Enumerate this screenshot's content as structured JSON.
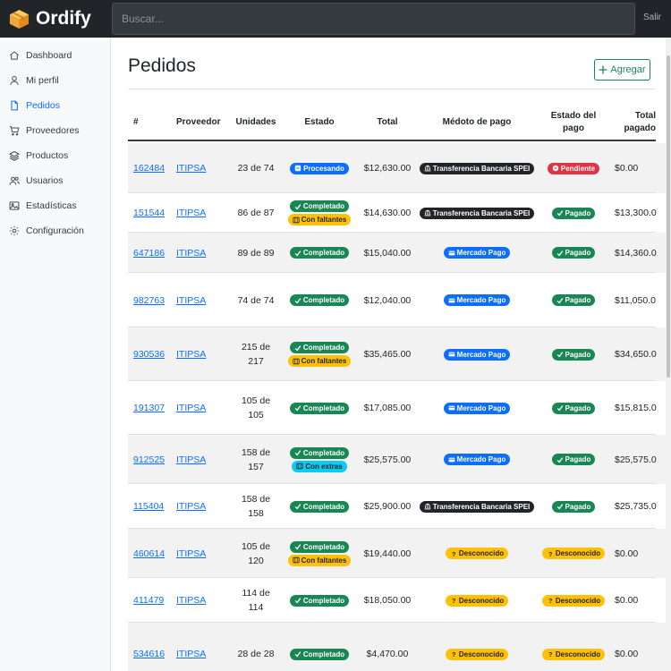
{
  "app": {
    "name": "Ordify"
  },
  "search": {
    "placeholder": "Buscar..."
  },
  "topbar": {
    "logout_label": "Salir"
  },
  "sidebar": {
    "items": [
      {
        "label": "Dashboard",
        "icon": "home-icon"
      },
      {
        "label": "Mi perfil",
        "icon": "user-icon"
      },
      {
        "label": "Pedidos",
        "icon": "file-icon",
        "active": true
      },
      {
        "label": "Proveedores",
        "icon": "cart-icon"
      },
      {
        "label": "Productos",
        "icon": "layers-icon"
      },
      {
        "label": "Usuarios",
        "icon": "users-icon"
      },
      {
        "label": "Estadísticas",
        "icon": "image-icon"
      },
      {
        "label": "Configuración",
        "icon": "gear-icon"
      }
    ]
  },
  "page": {
    "title": "Pedidos",
    "add_label": "Agregar"
  },
  "table": {
    "headers": {
      "num": "#",
      "proveedor": "Proveedor",
      "unidades": "Unidades",
      "estado": "Estado",
      "total": "Total",
      "metodo": "Médoto de pago",
      "estado_pago_1": "Estado del",
      "estado_pago_2": "pago",
      "total_pagado_1": "Total",
      "total_pagado_2": "pagado"
    },
    "rows": [
      {
        "id": "162484",
        "proveedor": "ITIPSA",
        "units1": "23 de 74",
        "units2": "",
        "estado": [
          {
            "label": "Procesando",
            "kind": "primary"
          }
        ],
        "total": "$12,630.00",
        "metodo": {
          "label": "Transferencia Bancaria SPEI",
          "kind": "dark"
        },
        "pago": {
          "label": "Pendiente",
          "kind": "danger"
        },
        "pagado": "$0.00"
      },
      {
        "id": "151544",
        "proveedor": "ITIPSA",
        "units1": "86 de 87",
        "units2": "",
        "estado": [
          {
            "label": "Completado",
            "kind": "success"
          },
          {
            "label": "Con faltantes",
            "kind": "warning"
          }
        ],
        "total": "$14,630.00",
        "metodo": {
          "label": "Transferencia Bancaria SPEI",
          "kind": "dark"
        },
        "pago": {
          "label": "Pagado",
          "kind": "success"
        },
        "pagado": "$13,300.0"
      },
      {
        "id": "647186",
        "proveedor": "ITIPSA",
        "units1": "89 de 89",
        "units2": "",
        "estado": [
          {
            "label": "Completado",
            "kind": "success"
          }
        ],
        "total": "$15,040.00",
        "metodo": {
          "label": "Mercado Pago",
          "kind": "primary"
        },
        "pago": {
          "label": "Pagado",
          "kind": "success"
        },
        "pagado": "$14,360.0"
      },
      {
        "id": "982763",
        "proveedor": "ITIPSA",
        "units1": "74 de 74",
        "units2": "",
        "estado": [
          {
            "label": "Completado",
            "kind": "success"
          }
        ],
        "total": "$12,040.00",
        "metodo": {
          "label": "Mercado Pago",
          "kind": "primary"
        },
        "pago": {
          "label": "Pagado",
          "kind": "success"
        },
        "pagado": "$11,050.0"
      },
      {
        "id": "930536",
        "proveedor": "ITIPSA",
        "units1": "215 de",
        "units2": "217",
        "estado": [
          {
            "label": "Completado",
            "kind": "success"
          },
          {
            "label": "Con faltantes",
            "kind": "warning"
          }
        ],
        "total": "$35,465.00",
        "metodo": {
          "label": "Mercado Pago",
          "kind": "primary"
        },
        "pago": {
          "label": "Pagado",
          "kind": "success"
        },
        "pagado": "$34,650.0"
      },
      {
        "id": "191307",
        "proveedor": "ITIPSA",
        "units1": "105 de",
        "units2": "105",
        "estado": [
          {
            "label": "Completado",
            "kind": "success"
          }
        ],
        "total": "$17,085.00",
        "metodo": {
          "label": "Mercado Pago",
          "kind": "primary"
        },
        "pago": {
          "label": "Pagado",
          "kind": "success"
        },
        "pagado": "$15,815.0"
      },
      {
        "id": "912525",
        "proveedor": "ITIPSA",
        "units1": "158 de",
        "units2": "157",
        "estado": [
          {
            "label": "Completado",
            "kind": "success"
          },
          {
            "label": "Con extras",
            "kind": "info"
          }
        ],
        "total": "$25,575.00",
        "metodo": {
          "label": "Mercado Pago",
          "kind": "primary"
        },
        "pago": {
          "label": "Pagado",
          "kind": "success"
        },
        "pagado": "$25,575.0"
      },
      {
        "id": "115404",
        "proveedor": "ITIPSA",
        "units1": "158 de",
        "units2": "158",
        "estado": [
          {
            "label": "Completado",
            "kind": "success"
          }
        ],
        "total": "$25,900.00",
        "metodo": {
          "label": "Transferencia Bancaria SPEI",
          "kind": "dark"
        },
        "pago": {
          "label": "Pagado",
          "kind": "success"
        },
        "pagado": "$25,735.0"
      },
      {
        "id": "460614",
        "proveedor": "ITIPSA",
        "units1": "105 de",
        "units2": "120",
        "estado": [
          {
            "label": "Completado",
            "kind": "success"
          },
          {
            "label": "Con faltantes",
            "kind": "warning"
          }
        ],
        "total": "$19,440.00",
        "metodo": {
          "label": "Desconocido",
          "kind": "warning"
        },
        "pago": {
          "label": "Desconocido",
          "kind": "warning"
        },
        "pagado": "$0.00"
      },
      {
        "id": "411479",
        "proveedor": "ITIPSA",
        "units1": "114 de",
        "units2": "114",
        "estado": [
          {
            "label": "Completado",
            "kind": "success"
          }
        ],
        "total": "$18,050.00",
        "metodo": {
          "label": "Desconocido",
          "kind": "warning"
        },
        "pago": {
          "label": "Desconocido",
          "kind": "warning"
        },
        "pagado": "$0.00"
      },
      {
        "id": "534616",
        "proveedor": "ITIPSA",
        "units1": "28 de 28",
        "units2": "",
        "estado": [
          {
            "label": "Completado",
            "kind": "success"
          }
        ],
        "total": "$4,470.00",
        "metodo": {
          "label": "Desconocido",
          "kind": "warning"
        },
        "pago": {
          "label": "Desconocido",
          "kind": "warning"
        },
        "pagado": "$0.00"
      }
    ]
  },
  "colors": {
    "brand": "#f0ad4e",
    "primary": "#0d6efd",
    "success": "#198754",
    "warning": "#ffc107",
    "danger": "#dc3545",
    "dark": "#212529",
    "info": "#0dcaf0"
  }
}
